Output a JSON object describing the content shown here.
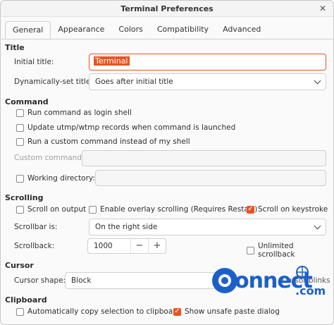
{
  "window": {
    "title": "Terminal Preferences",
    "close_glyph": "✕"
  },
  "tabs": [
    "General",
    "Appearance",
    "Colors",
    "Compatibility",
    "Advanced"
  ],
  "title_section": {
    "heading": "Title",
    "initial_title_label": "Initial title:",
    "initial_title_value": "Terminal",
    "dynamic_label": "Dynamically-set title:",
    "dynamic_value": "Goes after initial title"
  },
  "command_section": {
    "heading": "Command",
    "login_shell": "Run command as login shell",
    "update_records": "Update utmp/wtmp records when command is launched",
    "custom_command_check": "Run a custom command instead of my shell",
    "custom_command_label": "Custom command:",
    "working_dir": "Working directory:"
  },
  "scrolling_section": {
    "heading": "Scrolling",
    "scroll_output": "Scroll on output",
    "overlay": "Enable overlay scrolling (Requires Restart)",
    "scroll_keystroke": "Scroll on keystroke",
    "scrollbar_label": "Scrollbar is:",
    "scrollbar_value": "On the right side",
    "scrollback_label": "Scrollback:",
    "scrollback_value": "1000",
    "unlimited": "Unlimited scrollback",
    "minus": "−",
    "plus": "+"
  },
  "cursor_section": {
    "heading": "Cursor",
    "shape_label": "Cursor shape:",
    "shape_value": "Block",
    "blinks_partial": "Cursor blinks"
  },
  "clipboard_section": {
    "heading": "Clipboard",
    "auto_copy": "Automatically copy selection to clipboard",
    "unsafe_paste": "Show unsafe paste dialog"
  },
  "watermark": {
    "brand": "onnect",
    "sub": ".com"
  },
  "colors": {
    "accent": "#e95420",
    "watermark": "#1c5fc9"
  }
}
